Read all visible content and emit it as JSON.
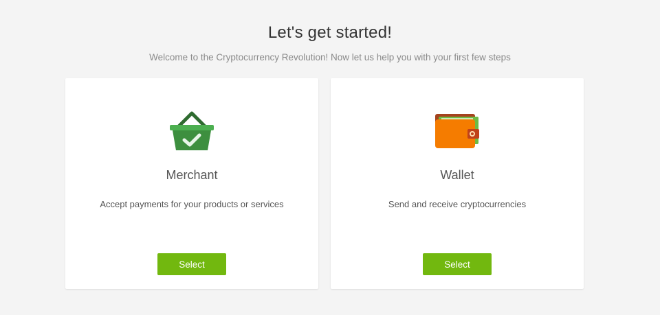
{
  "header": {
    "title": "Let's get started!",
    "subtitle": "Welcome to the Cryptocurrency Revolution! Now let us help you with your first few steps"
  },
  "cards": [
    {
      "icon": "shopping-basket-check-icon",
      "title": "Merchant",
      "description": "Accept payments for your products or services",
      "button_label": "Select"
    },
    {
      "icon": "wallet-icon",
      "title": "Wallet",
      "description": "Send and receive cryptocurrencies",
      "button_label": "Select"
    }
  ],
  "colors": {
    "background": "#f4f4f4",
    "card": "#ffffff",
    "button": "#72b80f",
    "basket_green": "#3d8f3f",
    "wallet_orange": "#f57c00"
  }
}
